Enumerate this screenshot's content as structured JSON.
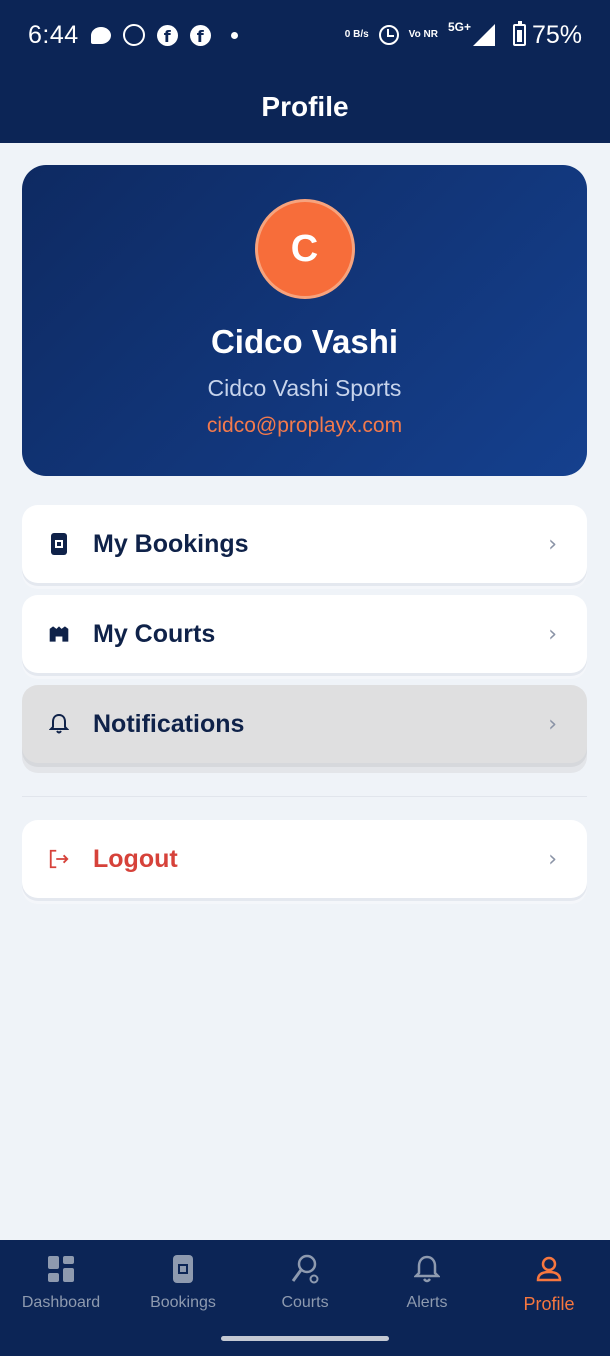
{
  "status_bar": {
    "time": "6:44",
    "data_rate": "0 B/s",
    "network_volte": "Vo NR",
    "network_type": "5G+",
    "battery": "75%"
  },
  "app_bar": {
    "title": "Profile"
  },
  "profile": {
    "avatar_initial": "C",
    "name": "Cidco Vashi",
    "organization": "Cidco Vashi Sports",
    "email": "cidco@proplayx.com"
  },
  "menu": {
    "items": [
      {
        "label": "My Bookings",
        "icon": "booking-icon"
      },
      {
        "label": "My Courts",
        "icon": "stadium-icon"
      },
      {
        "label": "Notifications",
        "icon": "bell-icon"
      }
    ],
    "logout_label": "Logout"
  },
  "bottom_nav": {
    "items": [
      {
        "label": "Dashboard",
        "icon": "dashboard-icon"
      },
      {
        "label": "Bookings",
        "icon": "booking-icon"
      },
      {
        "label": "Courts",
        "icon": "racket-icon"
      },
      {
        "label": "Alerts",
        "icon": "bell-icon"
      },
      {
        "label": "Profile",
        "icon": "user-icon"
      }
    ],
    "active_index": 4
  },
  "colors": {
    "primary_navy": "#0c2556",
    "accent_orange": "#f7773f",
    "danger_red": "#d6423a",
    "background": "#eff3f8"
  }
}
